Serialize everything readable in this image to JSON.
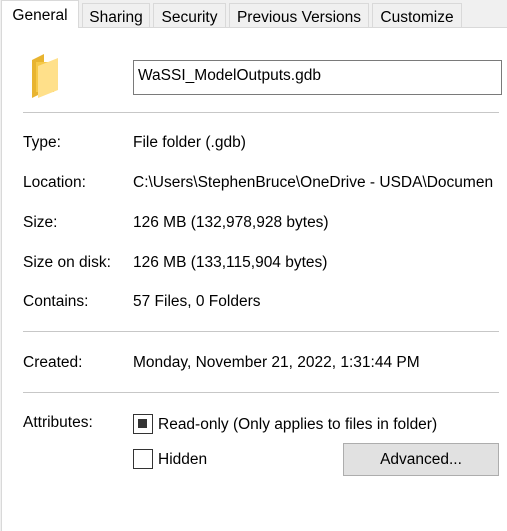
{
  "tabs": [
    {
      "label": "General",
      "active": true
    },
    {
      "label": "Sharing"
    },
    {
      "label": "Security"
    },
    {
      "label": "Previous Versions"
    },
    {
      "label": "Customize"
    }
  ],
  "name_field": {
    "value": "WaSSI_ModelOutputs.gdb"
  },
  "properties": {
    "type": {
      "label": "Type:",
      "value": "File folder (.gdb)"
    },
    "location": {
      "label": "Location:",
      "value": "C:\\Users\\StephenBruce\\OneDrive - USDA\\Documen"
    },
    "size": {
      "label": "Size:",
      "value": "126 MB (132,978,928 bytes)"
    },
    "size_on_disk": {
      "label": "Size on disk:",
      "value": "126 MB (133,115,904 bytes)"
    },
    "contains": {
      "label": "Contains:",
      "value": "57 Files, 0 Folders"
    },
    "created": {
      "label": "Created:",
      "value": "Monday, November 21, 2022, 1:31:44 PM"
    }
  },
  "attributes": {
    "label": "Attributes:",
    "readonly": {
      "label": "Read-only (Only applies to files in folder)",
      "state": "indeterminate"
    },
    "hidden": {
      "label": "Hidden",
      "checked": false
    },
    "advanced_button": "Advanced..."
  },
  "icons": {
    "folder": "folder-icon"
  },
  "colors": {
    "folder_light": "#ffe08a",
    "folder_dark": "#e8b430"
  }
}
